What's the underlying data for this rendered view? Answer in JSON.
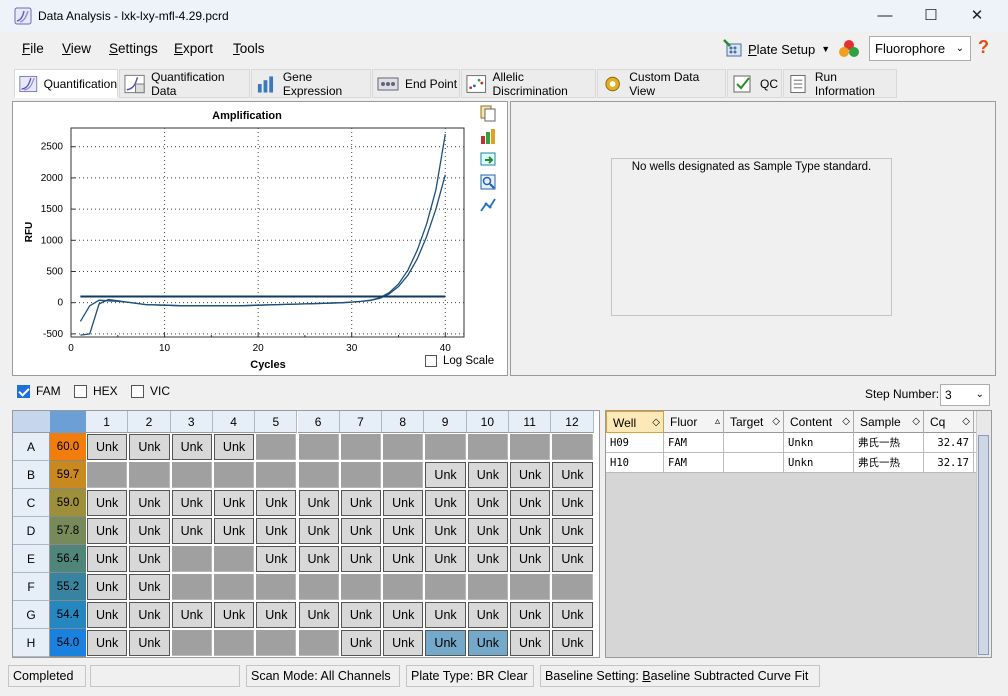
{
  "window": {
    "title": "Data Analysis - lxk-lxy-mfl-4.29.pcrd",
    "minimize": "—",
    "maximize": "☐",
    "close": "✕"
  },
  "menu": [
    {
      "label": "File",
      "ul": "F",
      "rest": "ile"
    },
    {
      "label": "View",
      "ul": "V",
      "rest": "iew"
    },
    {
      "label": "Settings",
      "ul": "S",
      "rest": "ettings"
    },
    {
      "label": "Export",
      "ul": "E",
      "rest": "xport"
    },
    {
      "label": "Tools",
      "ul": "T",
      "rest": "ools"
    }
  ],
  "toolbar": {
    "plate_setup_ul": "P",
    "plate_setup_rest": "late Setup",
    "fluorophore": "Fluorophore",
    "help": "?"
  },
  "tabs": [
    {
      "label": "Quantification",
      "icon": "amplification-icon",
      "active": true
    },
    {
      "label": "Quantification Data",
      "icon": "quant-data-icon"
    },
    {
      "label": "Gene Expression",
      "icon": "bar-chart-icon"
    },
    {
      "label": "End Point",
      "icon": "end-point-icon"
    },
    {
      "label": "Allelic Discrimination",
      "icon": "scatter-icon"
    },
    {
      "label": "Custom Data View",
      "icon": "gear-icon"
    },
    {
      "label": "QC",
      "icon": "qc-check-icon"
    },
    {
      "label": "Run Information",
      "icon": "document-icon"
    }
  ],
  "chart_data": {
    "type": "line",
    "title": "Amplification",
    "xlabel": "Cycles",
    "ylabel": "RFU",
    "xlim": [
      0,
      42
    ],
    "ylim": [
      -550,
      2800
    ],
    "xticks": [
      0,
      10,
      20,
      30,
      40
    ],
    "yticks": [
      -500,
      0,
      500,
      1000,
      1500,
      2000,
      2500
    ],
    "threshold": 100,
    "grid": true,
    "series": [
      {
        "x": [
          1,
          2,
          3,
          4,
          5,
          6,
          8,
          10,
          12,
          15,
          18,
          20,
          22,
          25,
          27,
          29,
          30,
          31,
          32,
          33,
          34,
          35,
          36,
          37,
          38,
          39,
          40
        ],
        "y": [
          -520,
          -500,
          -20,
          50,
          30,
          10,
          -30,
          -40,
          -50,
          -50,
          -50,
          -40,
          -30,
          -20,
          -10,
          0,
          10,
          20,
          40,
          80,
          160,
          300,
          520,
          840,
          1260,
          1810,
          2700
        ]
      },
      {
        "x": [
          1,
          2,
          3,
          4,
          5,
          6,
          8,
          10,
          12,
          15,
          18,
          20,
          22,
          25,
          27,
          29,
          30,
          31,
          32,
          33,
          34,
          35,
          36,
          37,
          38,
          39,
          40
        ],
        "y": [
          -300,
          -50,
          40,
          30,
          20,
          10,
          -30,
          -40,
          -50,
          -50,
          -50,
          -40,
          -30,
          -20,
          -10,
          0,
          10,
          20,
          35,
          70,
          140,
          260,
          440,
          700,
          1060,
          1500,
          2050
        ]
      }
    ],
    "log_scale_label": "Log Scale"
  },
  "right_panel": {
    "message": "No wells designated as Sample Type standard."
  },
  "fluors": [
    {
      "label": "FAM",
      "checked": true
    },
    {
      "label": "HEX",
      "checked": false
    },
    {
      "label": "VIC",
      "checked": false
    }
  ],
  "step": {
    "label": "Step Number:",
    "value": "3"
  },
  "plate": {
    "columns": [
      "1",
      "2",
      "3",
      "4",
      "5",
      "6",
      "7",
      "8",
      "9",
      "10",
      "11",
      "12"
    ],
    "rows": [
      {
        "label": "A",
        "temp": "60.0",
        "color": "#f07d0c",
        "wells": [
          1,
          1,
          1,
          1,
          0,
          0,
          0,
          0,
          0,
          0,
          0,
          0
        ]
      },
      {
        "label": "B",
        "temp": "59.7",
        "color": "#c9891f",
        "wells": [
          0,
          0,
          0,
          0,
          0,
          0,
          0,
          0,
          1,
          1,
          1,
          1
        ]
      },
      {
        "label": "C",
        "temp": "59.0",
        "color": "#9e8f3a",
        "wells": [
          1,
          1,
          1,
          1,
          1,
          1,
          1,
          1,
          1,
          1,
          1,
          1
        ]
      },
      {
        "label": "D",
        "temp": "57.8",
        "color": "#778a5a",
        "wells": [
          1,
          1,
          1,
          1,
          1,
          1,
          1,
          1,
          1,
          1,
          1,
          1
        ]
      },
      {
        "label": "E",
        "temp": "56.4",
        "color": "#50857a",
        "wells": [
          1,
          1,
          0,
          0,
          1,
          1,
          1,
          1,
          1,
          1,
          1,
          1
        ]
      },
      {
        "label": "F",
        "temp": "55.2",
        "color": "#3884a0",
        "wells": [
          1,
          1,
          0,
          0,
          0,
          0,
          0,
          0,
          0,
          0,
          0,
          0
        ]
      },
      {
        "label": "G",
        "temp": "54.4",
        "color": "#2686bf",
        "wells": [
          1,
          1,
          1,
          1,
          1,
          1,
          1,
          1,
          1,
          1,
          1,
          1
        ]
      },
      {
        "label": "H",
        "temp": "54.0",
        "color": "#1a82de",
        "wells": [
          1,
          1,
          0,
          0,
          0,
          0,
          1,
          1,
          2,
          2,
          1,
          1
        ]
      }
    ],
    "well_label": "Unk"
  },
  "well_table": {
    "headers": [
      "Well",
      "Fluor",
      "Target",
      "Content",
      "Sample",
      "Cq"
    ],
    "rows": [
      [
        "H09",
        "FAM",
        "",
        "Unkn",
        "弗氏一热",
        "32.47"
      ],
      [
        "H10",
        "FAM",
        "",
        "Unkn",
        "弗氏一热",
        "32.17"
      ]
    ]
  },
  "status": {
    "state": "Completed",
    "scan_mode": "Scan Mode: All Channels",
    "plate_type": "Plate Type: BR Clear",
    "baseline_prefix": "Baseline Setting: ",
    "baseline_ul": "B",
    "baseline_rest": "aseline Subtracted Curve Fit"
  }
}
